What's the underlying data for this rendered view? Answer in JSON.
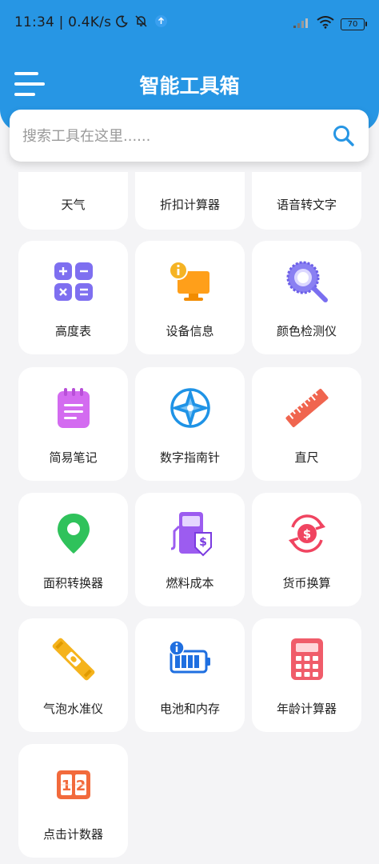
{
  "status_bar": {
    "time": "11:34",
    "speed": "0.4K/s",
    "battery": "70",
    "icons": [
      "moon-icon",
      "mute-bell-icon",
      "upload-badge-icon",
      "signal-icon",
      "wifi-icon",
      "battery-icon"
    ]
  },
  "header": {
    "title": "智能工具箱",
    "menu_icon": "hamburger-icon",
    "accent_color": "#2796e4"
  },
  "search": {
    "placeholder": "搜索工具在这里......",
    "icon": "search-icon"
  },
  "tools": [
    {
      "label": "天气",
      "icon": "weather-icon"
    },
    {
      "label": "折扣计算器",
      "icon": "discount-icon"
    },
    {
      "label": "语音转文字",
      "icon": "speech-icon"
    },
    {
      "label": "高度表",
      "icon": "calculator-grid-icon"
    },
    {
      "label": "设备信息",
      "icon": "device-info-icon"
    },
    {
      "label": "颜色检测仪",
      "icon": "color-detector-icon"
    },
    {
      "label": "简易笔记",
      "icon": "notepad-icon"
    },
    {
      "label": "数字指南针",
      "icon": "compass-icon"
    },
    {
      "label": "直尺",
      "icon": "ruler-icon"
    },
    {
      "label": "面积转换器",
      "icon": "location-pin-icon"
    },
    {
      "label": "燃料成本",
      "icon": "fuel-pump-icon"
    },
    {
      "label": "货币换算",
      "icon": "currency-exchange-icon"
    },
    {
      "label": "气泡水准仪",
      "icon": "spirit-level-icon"
    },
    {
      "label": "电池和内存",
      "icon": "battery-info-icon"
    },
    {
      "label": "年龄计算器",
      "icon": "calculator-icon"
    },
    {
      "label": "点击计数器",
      "icon": "tally-counter-icon"
    }
  ]
}
